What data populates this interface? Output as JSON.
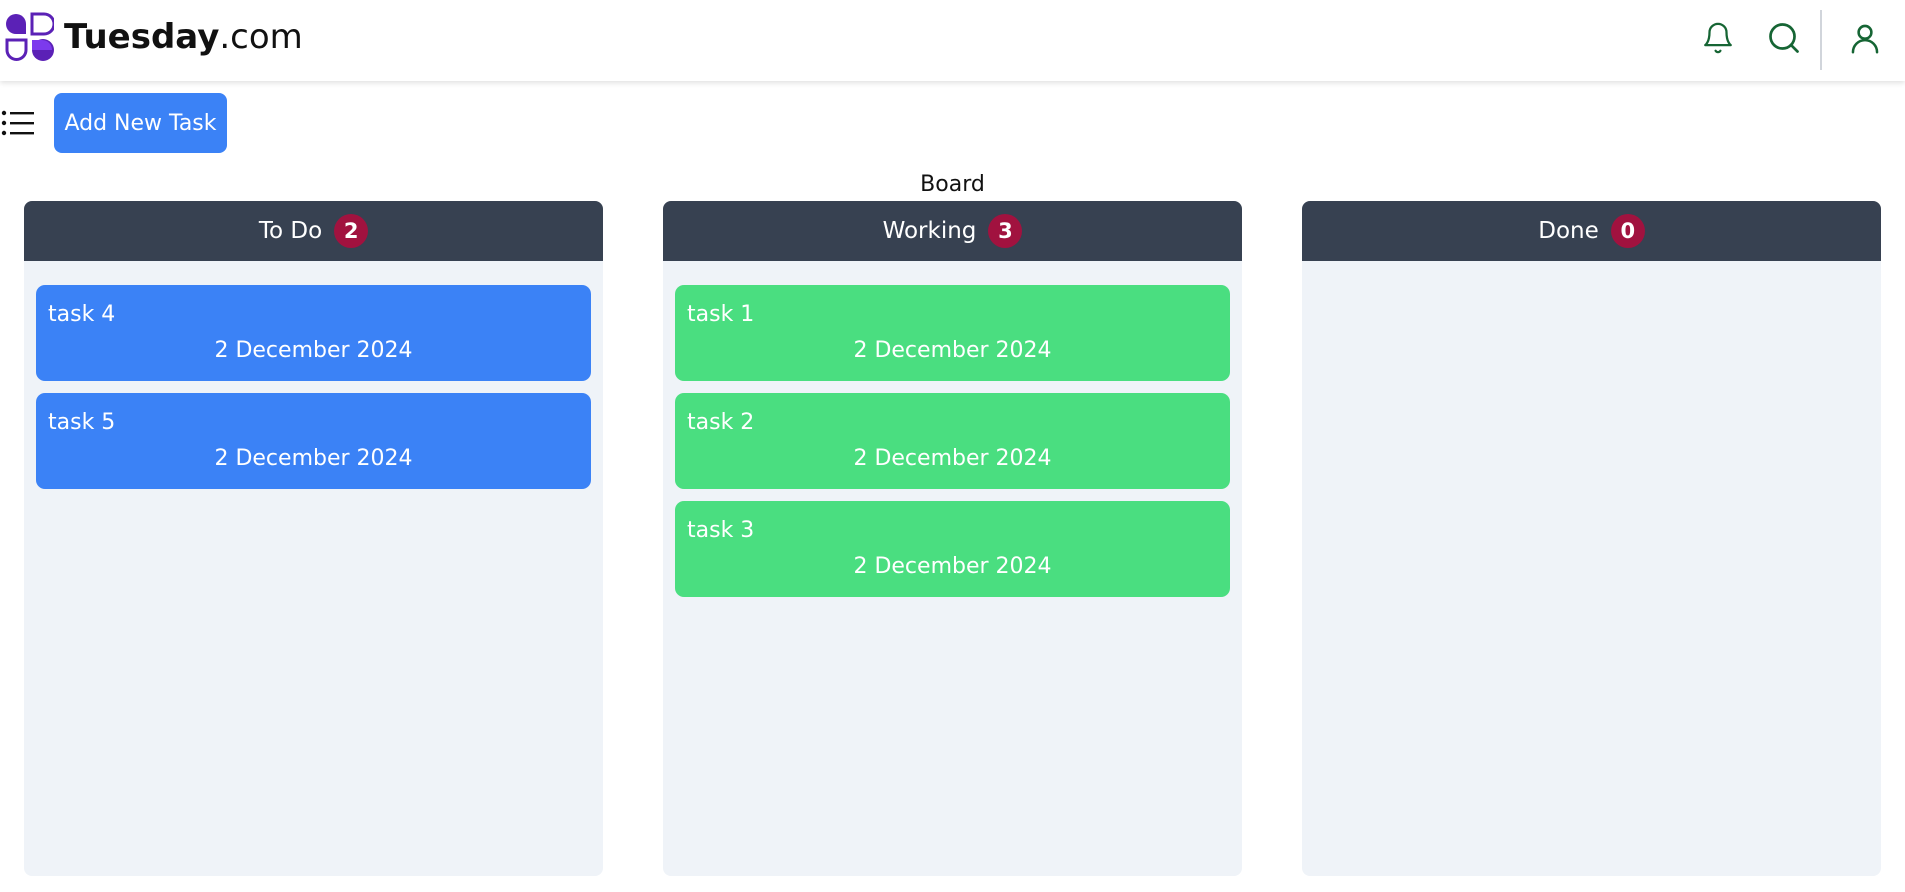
{
  "header": {
    "brand_bold": "Tuesday",
    "brand_rest": ".com",
    "icons": [
      "bell-icon",
      "search-icon",
      "user-icon"
    ],
    "icon_color": "#166534"
  },
  "toolbar": {
    "add_task_label": "Add New Task"
  },
  "board": {
    "title": "Board",
    "columns": [
      {
        "title": "To Do",
        "count": "2",
        "card_color": "#3b82f6",
        "tasks": [
          {
            "name": "task 4",
            "date": "2 December 2024"
          },
          {
            "name": "task 5",
            "date": "2 December 2024"
          }
        ]
      },
      {
        "title": "Working",
        "count": "3",
        "card_color": "#4ade80",
        "tasks": [
          {
            "name": "task 1",
            "date": "2 December 2024"
          },
          {
            "name": "task 2",
            "date": "2 December 2024"
          },
          {
            "name": "task 3",
            "date": "2 December 2024"
          }
        ]
      },
      {
        "title": "Done",
        "count": "0",
        "card_color": "",
        "tasks": []
      }
    ]
  },
  "colors": {
    "column_header": "#374151",
    "column_body": "#eff3f8",
    "badge": "#a1123f",
    "primary": "#3b82f6",
    "logo": "#5b21b6"
  }
}
